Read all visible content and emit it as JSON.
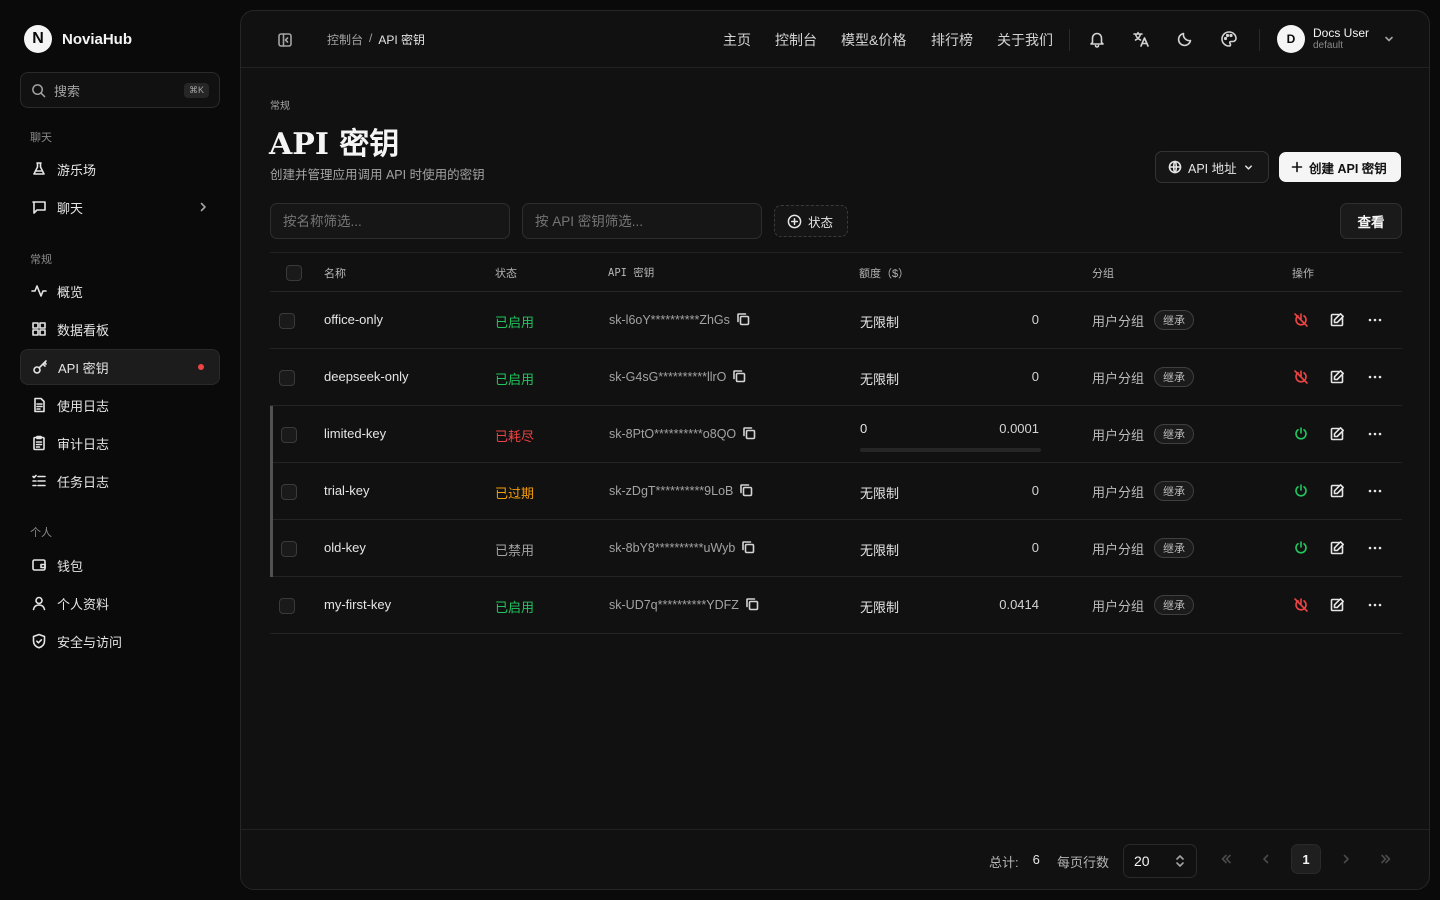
{
  "brand": {
    "name": "NoviaHub",
    "logo_letter": "N"
  },
  "search": {
    "label": "搜索",
    "shortcut": "⌘K"
  },
  "sidebar": {
    "sections": [
      {
        "title": "聊天",
        "items": [
          {
            "label": "游乐场",
            "icon": "flask-icon"
          },
          {
            "label": "聊天",
            "icon": "chat-icon",
            "has_submenu": true
          }
        ]
      },
      {
        "title": "常规",
        "items": [
          {
            "label": "概览",
            "icon": "activity-icon"
          },
          {
            "label": "数据看板",
            "icon": "dashboard-icon"
          },
          {
            "label": "API 密钥",
            "icon": "key-icon",
            "active": true
          },
          {
            "label": "使用日志",
            "icon": "document-icon"
          },
          {
            "label": "审计日志",
            "icon": "clipboard-icon"
          },
          {
            "label": "任务日志",
            "icon": "list-icon"
          }
        ]
      },
      {
        "title": "个人",
        "items": [
          {
            "label": "钱包",
            "icon": "wallet-icon"
          },
          {
            "label": "个人资料",
            "icon": "user-icon"
          },
          {
            "label": "安全与访问",
            "icon": "shield-icon"
          }
        ]
      }
    ]
  },
  "header": {
    "breadcrumb": {
      "parent": "控制台",
      "separator": "/",
      "current": "API 密钥"
    },
    "nav": [
      "主页",
      "控制台",
      "模型&价格",
      "排行榜",
      "关于我们"
    ],
    "user": {
      "initial": "D",
      "name": "Docs User",
      "group": "default"
    }
  },
  "page": {
    "section": "常规",
    "title": "API 密钥",
    "description": "创建并管理应用调用 API 时使用的密钥",
    "api_address_button": "API 地址",
    "create_button": "创建 API 密钥",
    "view_button": "查看",
    "filter_name_placeholder": "按名称筛选...",
    "filter_key_placeholder": "按 API 密钥筛选...",
    "status_filter": "状态"
  },
  "table": {
    "columns": [
      "名称",
      "状态",
      "API 密钥",
      "额度（$）",
      "分组",
      "操作"
    ],
    "rows": [
      {
        "name": "office-only",
        "status": "已启用",
        "status_color": "#22c55e",
        "key": "sk-l6oY**********ZhGs",
        "quota": "无限制",
        "used": "0",
        "group": "用户分组",
        "badge": "继承",
        "toggle": "disable"
      },
      {
        "name": "deepseek-only",
        "status": "已启用",
        "status_color": "#22c55e",
        "key": "sk-G4sG**********llrO",
        "quota": "无限制",
        "used": "0",
        "group": "用户分组",
        "badge": "继承",
        "toggle": "disable"
      },
      {
        "name": "limited-key",
        "status": "已耗尽",
        "status_color": "#ef4444",
        "key": "sk-8PtO**********o8QO",
        "quota": "0",
        "used": "0.0001",
        "group": "用户分组",
        "badge": "继承",
        "toggle": "enable"
      },
      {
        "name": "trial-key",
        "status": "已过期",
        "status_color": "#f59e0b",
        "key": "sk-zDgT**********9LoB",
        "quota": "无限制",
        "used": "0",
        "group": "用户分组",
        "badge": "继承",
        "toggle": "enable"
      },
      {
        "name": "old-key",
        "status": "已禁用",
        "status_color": "#a3a3a3",
        "key": "sk-8bY8**********uWyb",
        "quota": "无限制",
        "used": "0",
        "group": "用户分组",
        "badge": "继承",
        "toggle": "enable"
      },
      {
        "name": "my-first-key",
        "status": "已启用",
        "status_color": "#22c55e",
        "key": "sk-UD7q**********YDFZ",
        "quota": "无限制",
        "used": "0.0414",
        "group": "用户分组",
        "badge": "继承",
        "toggle": "disable"
      }
    ]
  },
  "footer": {
    "total_label": "总计:",
    "total": "6",
    "per_page_label": "每页行数",
    "per_page": "20",
    "current_page": "1"
  }
}
